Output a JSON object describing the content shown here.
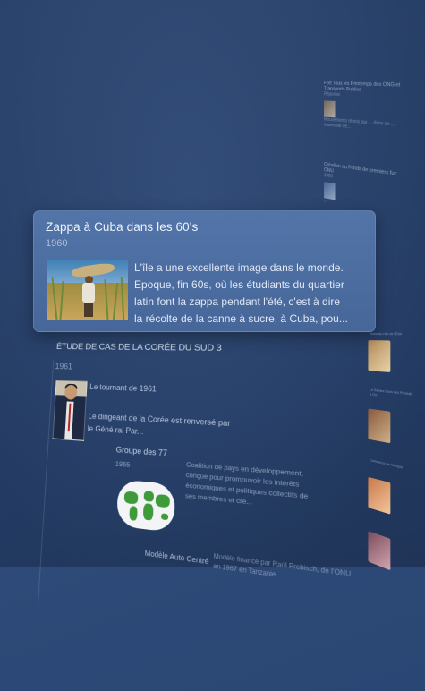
{
  "main_card": {
    "title": "Zappa à Cuba dans les 60's",
    "year": "1960",
    "lines": [
      "L'île a une excellente image dans le monde.",
      "Epoque, fin 60s, où les étudiants du quartier",
      "latin font la zappa pendant l'été, c'est à dire",
      "la récolte de la canne à sucre, à Cuba, pou..."
    ]
  },
  "korea_card": {
    "title": "ÉTUDE DE CAS DE LA CORÉE DU SUD 3",
    "year": "1961",
    "p1": "Le tournant de 1961",
    "p2": "Le dirigeant de la Corée est renversé par le Géné ral Par..."
  },
  "g77_card": {
    "title": "Groupe des 77",
    "year": "1965",
    "text": "Coalition de pays en développement, conçue pour promouvoir les intérêts économiques et politiques collectifs de ses membres et cré..."
  },
  "auto_card": {
    "title": "Modèle Auto Centré",
    "text": "Modèle financé par Raúl Prebisch, de l'ONU en 1967 en Tanzanie"
  },
  "far_cards": [
    {
      "title": "Fort Tous les Printemps des ONG et Transports Publics",
      "sub": "Réponse",
      "body": "Mouvements réunis par ... dans un ... ensemble de..."
    },
    {
      "title": "Création du Fonds de premiers fuz ONU",
      "sub": "1960",
      "body": "..."
    },
    {
      "title": "Interdiction...",
      "sub": "",
      "body": "..."
    }
  ],
  "strip": [
    {
      "label": "Nouveau rôle de l'État"
    },
    {
      "label": "Le Sahara Sous Les Produits à l'Or"
    },
    {
      "label": "Commerce de l'Afrique"
    }
  ]
}
